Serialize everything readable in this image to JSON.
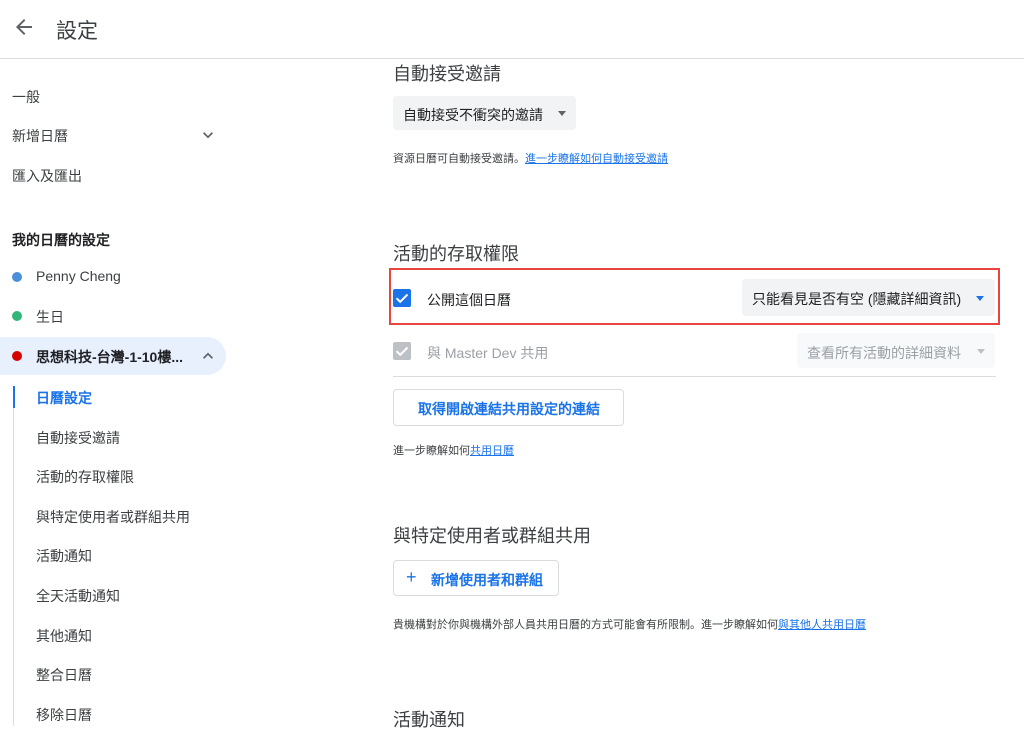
{
  "header": {
    "title": "設定"
  },
  "sidebar": {
    "general": "一般",
    "add_calendar": "新增日曆",
    "import_export": "匯入及匯出",
    "my_calendars_heading": "我的日曆的設定",
    "calendars": [
      {
        "label": "Penny Cheng",
        "color": "#4a90d9"
      },
      {
        "label": "生日",
        "color": "#33b679"
      },
      {
        "label": "思想科技-台灣-1-10樓...",
        "color": "#d50000"
      }
    ],
    "sub_items": [
      "日曆設定",
      "自動接受邀請",
      "活動的存取權限",
      "與特定使用者或群組共用",
      "活動通知",
      "全天活動通知",
      "其他通知",
      "整合日曆",
      "移除日曆"
    ]
  },
  "auto_accept": {
    "title": "自動接受邀請",
    "dropdown_value": "自動接受不衝突的邀請",
    "helper_text": "資源日曆可自動接受邀請。",
    "helper_link": "進一步瞭解如何自動接受邀請"
  },
  "access": {
    "title": "活動的存取權限",
    "public_label": "公開這個日曆",
    "public_checked": true,
    "public_dropdown": "只能看見是否有空 (隱藏詳細資訊)",
    "share_label": "與 Master Dev 共用",
    "share_dropdown": "查看所有活動的詳細資料",
    "link_button": "取得開啟連結共用設定的連結",
    "helper_text": "進一步瞭解如何",
    "helper_link": "共用日曆"
  },
  "share_specific": {
    "title": "與特定使用者或群組共用",
    "add_button": "新增使用者和群組",
    "helper_text": "貴機構對於你與機構外部人員共用日曆的方式可能會有所限制。進一步瞭解如何",
    "helper_link": "與其他人共用日曆"
  },
  "notifications": {
    "title": "活動通知"
  },
  "colors": {
    "accent": "#1a73e8",
    "highlight": "#e8453c",
    "disabled": "#bdc1c6"
  }
}
